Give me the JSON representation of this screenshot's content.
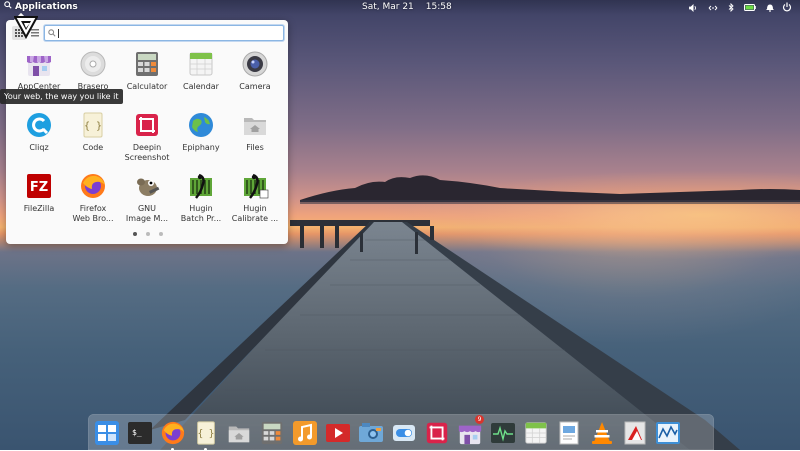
{
  "panel": {
    "applications_label": "Applications",
    "date": "Sat, Mar 21",
    "time": "15:58",
    "indicators": [
      "volume-icon",
      "network-icon",
      "bluetooth-icon",
      "battery-icon",
      "notifications-icon"
    ],
    "power_icon": "power-icon"
  },
  "launcher": {
    "search": {
      "value": "",
      "placeholder": ""
    },
    "view_modes": [
      "grid-view-icon",
      "category-view-icon"
    ],
    "apps": [
      {
        "label": "AppCenter",
        "icon": "appcenter-icon"
      },
      {
        "label": "Brasero",
        "icon": "brasero-icon"
      },
      {
        "label": "Calculator",
        "icon": "calculator-icon"
      },
      {
        "label": "Calendar",
        "icon": "calendar-icon"
      },
      {
        "label": "Camera",
        "icon": "camera-icon"
      },
      {
        "label": "Cliqz",
        "icon": "cliqz-icon"
      },
      {
        "label": "Code",
        "icon": "code-icon"
      },
      {
        "label": "Deepin\nScreenshot",
        "icon": "deepin-screenshot-icon"
      },
      {
        "label": "Epiphany",
        "icon": "epiphany-icon"
      },
      {
        "label": "Files",
        "icon": "files-icon"
      },
      {
        "label": "FileZilla",
        "icon": "filezilla-icon"
      },
      {
        "label": "Firefox\nWeb Bro...",
        "icon": "firefox-icon"
      },
      {
        "label": "GNU\nImage M...",
        "icon": "gimp-icon"
      },
      {
        "label": "Hugin\nBatch Pr...",
        "icon": "hugin-batch-icon"
      },
      {
        "label": "Hugin\nCalibrate ...",
        "icon": "hugin-calibrate-icon"
      }
    ],
    "pages": {
      "count": 3,
      "current": 1
    },
    "tooltip": "Your web, the way you like it"
  },
  "dock": {
    "items": [
      {
        "name": "multitasking-view-icon",
        "running": false
      },
      {
        "name": "terminal-icon",
        "running": false
      },
      {
        "name": "firefox-icon",
        "running": true
      },
      {
        "name": "code-icon",
        "running": true
      },
      {
        "name": "files-icon",
        "running": false
      },
      {
        "name": "calculator-icon",
        "running": false
      },
      {
        "name": "music-icon",
        "running": false
      },
      {
        "name": "videos-icon",
        "running": false
      },
      {
        "name": "photos-icon",
        "running": false
      },
      {
        "name": "system-settings-icon",
        "running": false
      },
      {
        "name": "screenshot-icon",
        "running": false
      },
      {
        "name": "appcenter-icon",
        "running": false,
        "badge": "9"
      },
      {
        "name": "system-monitor-icon",
        "running": false
      },
      {
        "name": "calendar-icon",
        "running": false
      },
      {
        "name": "document-viewer-icon",
        "running": false
      },
      {
        "name": "vlc-icon",
        "running": false
      },
      {
        "name": "pdf-icon",
        "running": false
      },
      {
        "name": "activity-monitor-icon",
        "running": false
      }
    ]
  },
  "colors": {
    "accent": "#3689e6",
    "sunset_orange": "#f5b36f",
    "sky_purple": "#5a5779",
    "water_blue": "#46617a"
  }
}
